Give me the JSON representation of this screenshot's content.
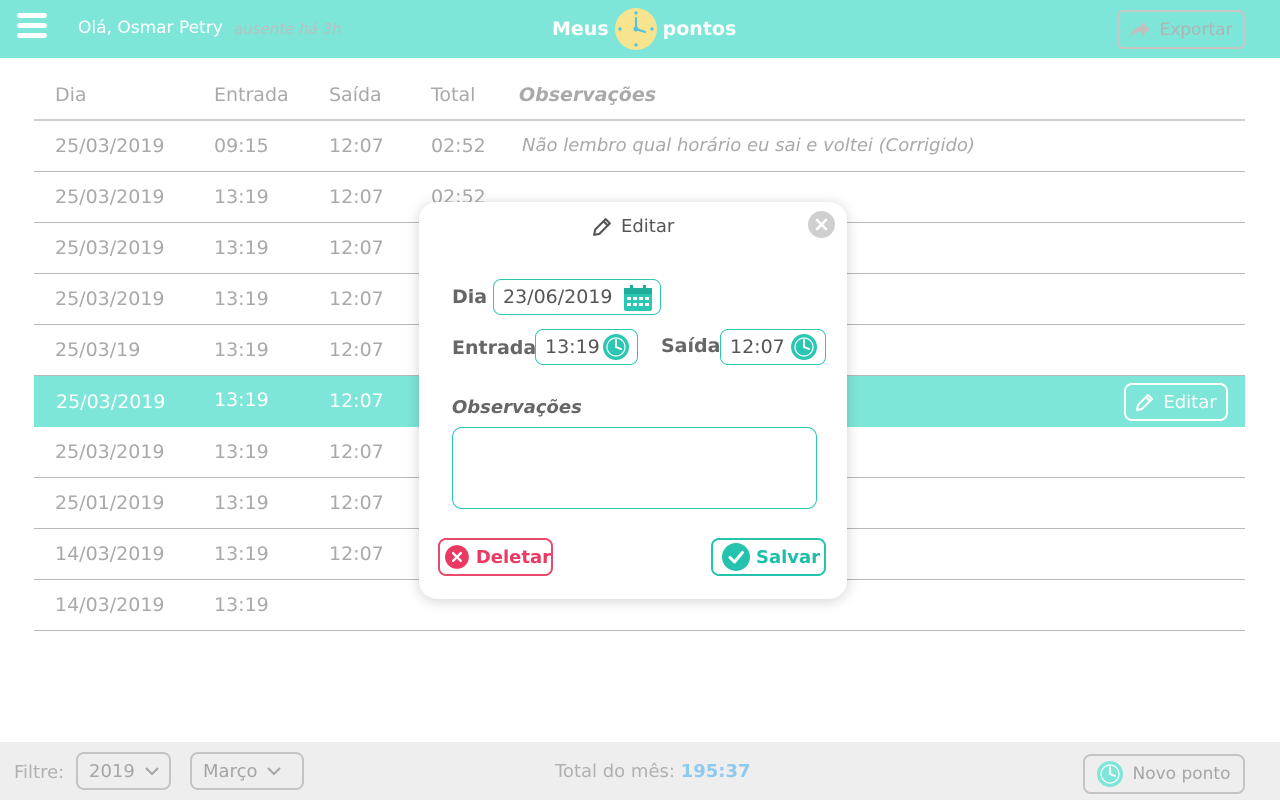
{
  "header": {
    "greeting": "Olá, Osmar Petry",
    "status": "ausente há 3h",
    "brand_left": "Meus",
    "brand_right": "pontos",
    "export_label": "Exportar"
  },
  "table": {
    "columns": [
      "Dia",
      "Entrada",
      "Saída",
      "Total",
      "Observações"
    ],
    "rows": [
      {
        "dia": "25/03/2019",
        "entrada": "09:15",
        "saida": "12:07",
        "total": "02:52",
        "obs": "Não lembro qual horário eu sai e voltei (Corrigido)"
      },
      {
        "dia": "25/03/2019",
        "entrada": "13:19",
        "saida": "12:07",
        "total": "02:52",
        "obs": ""
      },
      {
        "dia": "25/03/2019",
        "entrada": "13:19",
        "saida": "12:07",
        "total": "",
        "obs": ""
      },
      {
        "dia": "25/03/2019",
        "entrada": "13:19",
        "saida": "12:07",
        "total": "",
        "obs": ""
      },
      {
        "dia": "25/03/19",
        "entrada": "13:19",
        "saida": "12:07",
        "total": "",
        "obs": ""
      },
      {
        "dia": "25/03/2019",
        "entrada": "13:19",
        "saida": "12:07",
        "total": "",
        "obs": "",
        "selected": true
      },
      {
        "dia": "25/03/2019",
        "entrada": "13:19",
        "saida": "12:07",
        "total": "",
        "obs": ""
      },
      {
        "dia": "25/01/2019",
        "entrada": "13:19",
        "saida": "12:07",
        "total": "",
        "obs": ""
      },
      {
        "dia": "14/03/2019",
        "entrada": "13:19",
        "saida": "12:07",
        "total": "",
        "obs": ""
      },
      {
        "dia": "14/03/2019",
        "entrada": "13:19",
        "saida": "",
        "total": "",
        "obs": ""
      }
    ],
    "row_edit_label": "Editar"
  },
  "modal": {
    "title": "Editar",
    "dia_label": "Dia",
    "dia_value": "23/06/2019",
    "entrada_label": "Entrada",
    "entrada_value": "13:19",
    "saida_label": "Saída",
    "saida_value": "12:07",
    "obs_label": "Observações",
    "obs_value": "",
    "delete_label": "Deletar",
    "save_label": "Salvar"
  },
  "footer": {
    "filter_label": "Filtre:",
    "year": "2019",
    "month": "Março",
    "total_label": "Total do mês:",
    "total_value": "195:37",
    "new_label": "Novo ponto"
  },
  "colors": {
    "accent": "#7ee6d8",
    "teal": "#24c3ae",
    "danger": "#ea3a63",
    "total_highlight": "#8ec9ef"
  }
}
